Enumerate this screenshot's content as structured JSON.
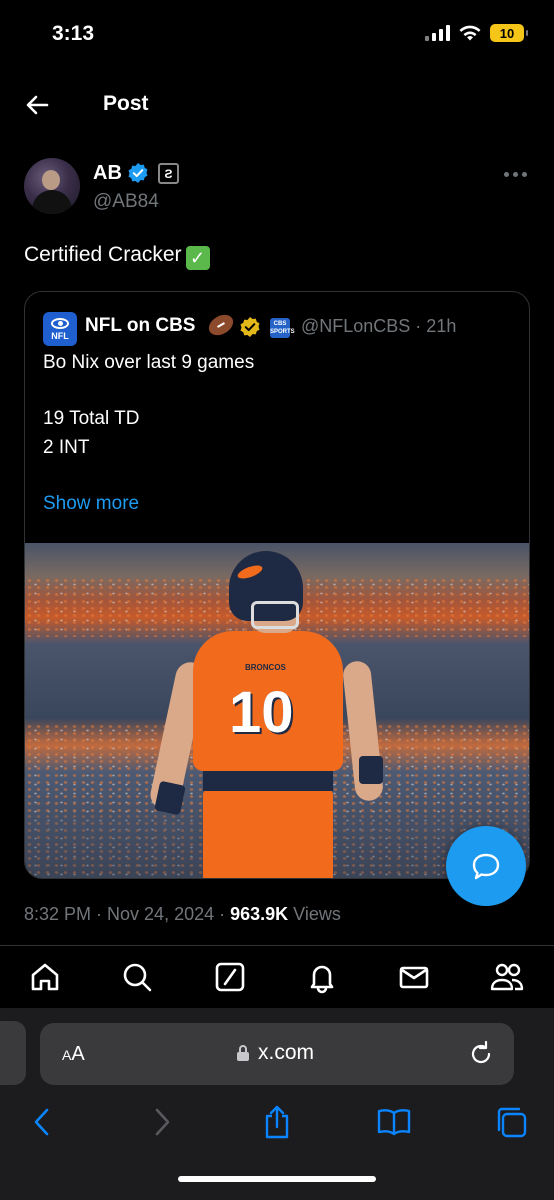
{
  "status_bar": {
    "time": "3:13",
    "battery": "10"
  },
  "header": {
    "title": "Post"
  },
  "tweet": {
    "author_name": "AB",
    "handle": "@AB84",
    "affiliation_badge": "Ƨ",
    "text": "Certified Cracker",
    "emoji": "✓"
  },
  "quote": {
    "name": "NFL on CBS",
    "avatar_label": "NFL",
    "affiliate_label": "CBS SPORTS",
    "handle_time": "@NFLonCBS · 21h",
    "lines": [
      "Bo Nix over last 9 games",
      "19 Total TD",
      "2 INT"
    ],
    "show_more": "Show more",
    "photo": {
      "jersey_number": "10",
      "wordmark": "BRONCOS"
    }
  },
  "meta": {
    "time_date": "8:32 PM · Nov 24, 2024 · ",
    "views_count": "963.9K",
    "views_label": " Views"
  },
  "safari": {
    "aa_small": "A",
    "aa_large": "A",
    "url": "x.com"
  },
  "colors": {
    "accent": "#1d9bf0",
    "background": "#000000",
    "secondary_text": "#71767b"
  },
  "icons": [
    "back-arrow-icon",
    "verified-icon",
    "more-icon",
    "home-icon",
    "search-icon",
    "grok-icon",
    "notifications-icon",
    "messages-icon",
    "communities-icon",
    "compose-reply-icon",
    "lock-icon",
    "reload-icon",
    "safari-back-icon",
    "safari-forward-icon",
    "share-icon",
    "bookmarks-icon",
    "tabs-icon"
  ]
}
